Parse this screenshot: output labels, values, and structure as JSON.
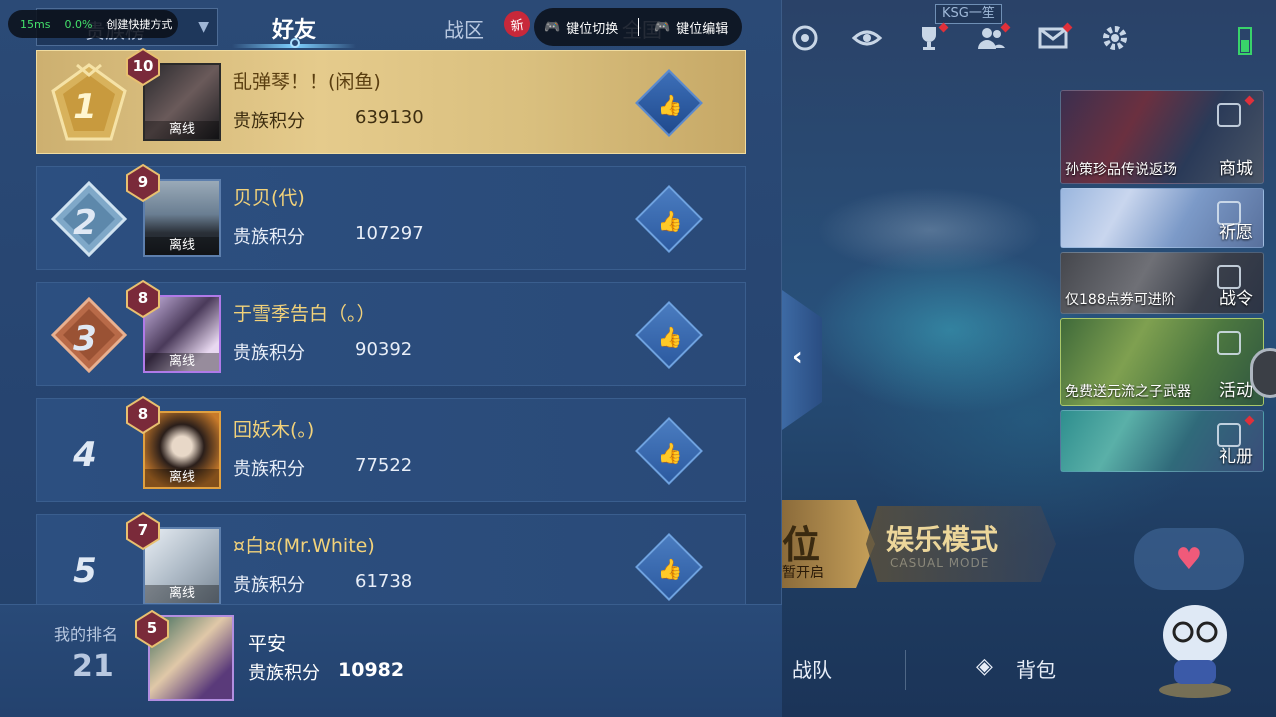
{
  "overlay": {
    "ping_ms": "15ms",
    "pct": "0.0%",
    "shortcut_label": "创建快捷方式",
    "key_switch": "键位切换",
    "key_edit": "键位编辑"
  },
  "tabs": {
    "dropdown_label": "贵族榜",
    "friends": "好友",
    "zone": "战区",
    "new_badge": "新",
    "nation": "全国"
  },
  "score_label": "贵族积分",
  "offline_label": "离线",
  "rows": [
    {
      "rank": "1",
      "level": "10",
      "name": "乱弹琴！！(闲鱼)",
      "score": "639130"
    },
    {
      "rank": "2",
      "level": "9",
      "name": "贝贝(代)",
      "score": "107297"
    },
    {
      "rank": "3",
      "level": "8",
      "name": "于雪季告白（。）",
      "score": "90392"
    },
    {
      "rank": "4",
      "level": "8",
      "name": "回妖木(。)",
      "score": "77522"
    },
    {
      "rank": "5",
      "level": "7",
      "name": "¤白¤(Mr.White)",
      "score": "61738"
    }
  ],
  "my_rank": {
    "label": "我的排名",
    "rank": "21",
    "level": "5",
    "name": "平安",
    "score_label": "贵族积分",
    "score": "10982"
  },
  "right": {
    "ksg_tag": "KSG一笙",
    "panels": [
      {
        "label": "孙策珍品传说返场",
        "tag": "商城"
      },
      {
        "label": "",
        "tag": "祈愿"
      },
      {
        "label": "仅188点券可进阶",
        "tag": "战令"
      },
      {
        "label": "免费送元流之子武器",
        "tag": "活动"
      },
      {
        "label": "",
        "tag": "礼册"
      }
    ],
    "mode_rank_big": "位",
    "mode_rank_small": "暂开启",
    "mode_fun_title": "娱乐模式",
    "mode_fun_sub": "CASUAL MODE",
    "nav_team": "战队",
    "nav_bag": "背包"
  },
  "colors": {
    "accent_gold": "#f2d27a",
    "first_row_bg": "#e5cb8c",
    "row_bg": "#2c4f80",
    "like_blue": "#4a7cc0"
  }
}
